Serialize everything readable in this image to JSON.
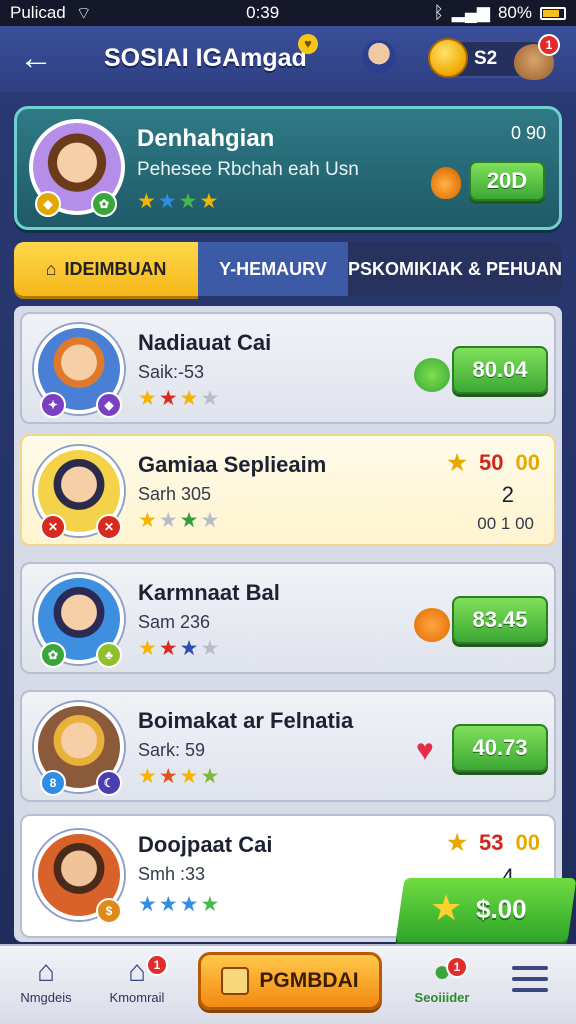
{
  "status_bar": {
    "carrier": "Pulicad",
    "time": "0:39",
    "battery": "80%",
    "icons": [
      "wifi-icon",
      "bluetooth-icon",
      "signal-icon",
      "battery-icon"
    ]
  },
  "header": {
    "title": "SOSIAI IGAmgad",
    "coin_value": "S2",
    "pet_notification": "1",
    "icons": [
      "back-arrow-icon",
      "coin-icon",
      "pet-icon",
      "avatar-icon"
    ]
  },
  "player": {
    "name": "Denhahgian",
    "subtitle": "Pehesee Rbchah eah Usn",
    "score_small": "0 90",
    "button_value": "20D",
    "stars": [
      "★",
      "★",
      "★",
      "★"
    ],
    "star_colors": [
      "#f4b400",
      "#2f8de4",
      "#49b84a",
      "#f4b400"
    ]
  },
  "tabs": [
    {
      "label": "IDEIMBUAN",
      "icon": "⌂"
    },
    {
      "label": "Y-HEMAURV"
    },
    {
      "label": "PSKOMIKIAK & PEHUAN"
    }
  ],
  "rows": [
    {
      "name": "Nadiauat Cai",
      "sub": "Saik:-53",
      "value": "80.04",
      "stars": [
        "★",
        "★",
        "★",
        "★"
      ],
      "star_colors": [
        "#f4b400",
        "#d72b1f",
        "#f4b400",
        "#b8bcc8"
      ],
      "icon": "bell-icon"
    },
    {
      "name": "Gamiaa Seplieaim",
      "sub": "Sarh 305",
      "score_a": "50",
      "score_b": "00",
      "rank": "2",
      "time": "00 1 00",
      "stars": [
        "★",
        "★",
        "★",
        "★"
      ],
      "star_colors": [
        "#f4b400",
        "#b8bcc8",
        "#2f9e3b",
        "#b8bcc8"
      ]
    },
    {
      "name": "Karmnaat Bal",
      "sub": "Sam 236",
      "value": "83.45",
      "stars": [
        "★",
        "★",
        "★",
        "★"
      ],
      "star_colors": [
        "#f4b400",
        "#d72b1f",
        "#2f4fb0",
        "#b8bcc8"
      ],
      "icon": "bell-icon"
    },
    {
      "name": "Boimakat ar Felnatia",
      "sub": "Sark: 59",
      "value": "40.73",
      "stars": [
        "★",
        "★",
        "★",
        "★"
      ],
      "star_colors": [
        "#f4b400",
        "#e2521b",
        "#f4b400",
        "#7fb83a"
      ],
      "icon": "heart-icon"
    },
    {
      "name": "Doojpaat Cai",
      "sub": "Smh :33",
      "score_a": "53",
      "score_b": "00",
      "rank": "4",
      "stars": [
        "★",
        "★",
        "★",
        "★"
      ],
      "star_colors": [
        "#2f8de4",
        "#2f8de4",
        "#2f8de4",
        "#49b84a"
      ]
    }
  ],
  "floating_reward": "$.00",
  "bottom_nav": [
    {
      "label": "Nmgdeis",
      "icon": "home-icon"
    },
    {
      "label": "Kmomrail",
      "icon": "home-alert-icon",
      "badge": "1"
    },
    {
      "label": "PGMBDAI",
      "icon": "box-icon"
    },
    {
      "label": "Seoiiider",
      "icon": "chat-icon",
      "badge": "1"
    },
    {
      "label": "",
      "icon": "menu-icon"
    }
  ],
  "colors": {
    "accent_yellow": "#f5b61a",
    "accent_green": "#3ca834",
    "header_blue": "#2e3f82",
    "teal_card": "#2f7a86"
  }
}
